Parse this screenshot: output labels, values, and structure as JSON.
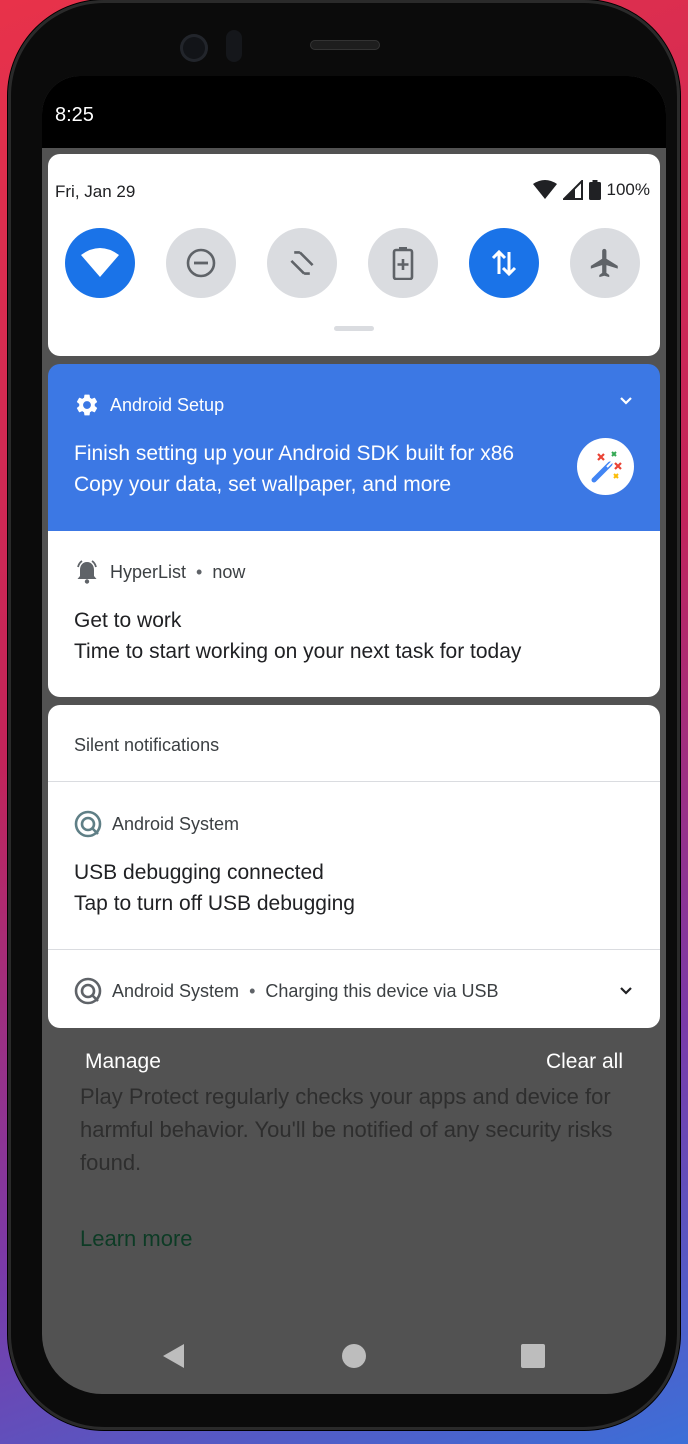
{
  "status_bar": {
    "time": "8:25"
  },
  "quick_settings": {
    "date": "Fri, Jan 29",
    "battery_percent": "100%",
    "tiles": [
      {
        "name": "wifi",
        "icon": "wifi-icon",
        "active": true
      },
      {
        "name": "do-not-disturb",
        "icon": "do-not-disturb-icon",
        "active": false
      },
      {
        "name": "auto-rotate",
        "icon": "auto-rotate-icon",
        "active": false
      },
      {
        "name": "battery-saver",
        "icon": "battery-saver-icon",
        "active": false
      },
      {
        "name": "mobile-data",
        "icon": "mobile-data-icon",
        "active": true
      },
      {
        "name": "airplane-mode",
        "icon": "airplane-icon",
        "active": false
      }
    ]
  },
  "notifications": {
    "setup": {
      "app": "Android Setup",
      "title": "Finish setting up your Android SDK built for x86",
      "text": "Copy your data, set wallpaper, and more",
      "accent": "#3c78e4"
    },
    "hyperlist": {
      "app": "HyperList",
      "separator": "•",
      "time": "now",
      "title": "Get to work",
      "text": "Time to start working on your next task for today"
    },
    "silent_header": "Silent notifications",
    "usb_debug": {
      "app": "Android System",
      "title": "USB debugging connected",
      "text": "Tap to turn off USB debugging"
    },
    "usb_charge": {
      "app": "Android System",
      "separator": "•",
      "summary": "Charging this device via USB"
    }
  },
  "footer": {
    "manage": "Manage",
    "clear_all": "Clear all"
  },
  "background_app": {
    "text": "Play Protect regularly checks your apps and device for harmful behavior. You'll be notified of any security risks found.",
    "link": "Learn more"
  },
  "colors": {
    "tile_active": "#1a73e8",
    "tile_inactive": "#dadce0"
  }
}
